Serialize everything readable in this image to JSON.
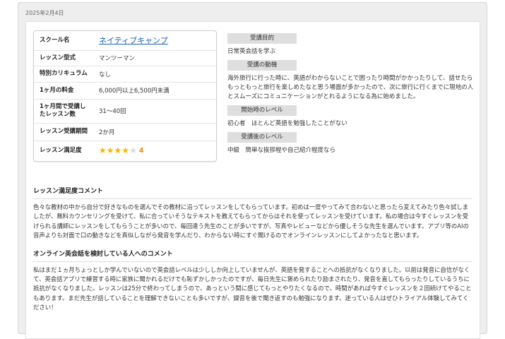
{
  "date": "2025年2月4日",
  "info": {
    "school": {
      "label": "スクール名",
      "value": "ネイティブキャンプ"
    },
    "lesson_type": {
      "label": "レッスン型式",
      "value": "マンツーマン"
    },
    "curriculum": {
      "label": "特別カリキュラム",
      "value": "なし"
    },
    "fee": {
      "label": "1ヶ月の料金",
      "value": "6,000円以上6,500円未満"
    },
    "lessons": {
      "label": "1ヶ月間で受講したレッスン数",
      "value": "31～40回"
    },
    "period": {
      "label": "レッスン受講期間",
      "value": "2か月"
    },
    "satisfaction": {
      "label": "レッスン満足度",
      "stars": 4,
      "max": 5,
      "value": "4"
    }
  },
  "sections": {
    "purpose": {
      "title": "受講目的",
      "text": "日常英会話を学ぶ"
    },
    "motive": {
      "title": "受講の動機",
      "text": "海外旅行に行った時に、英語がわからないことで困ったり時間がかかったりして、話せたらもっともっと旅行を楽しめたなと思う場面が多かったので、次に旅行に行くまでに現地の人とスムーズにコミュニケーションがとれるようになる為に始めました。"
    },
    "start_level": {
      "title": "開始時のレベル",
      "text": "初心者　ほとんど英語を勉強したことがない"
    },
    "after_level": {
      "title": "受講後のレベル",
      "text": "中級　簡単な挨拶程や自己紹介程度なら"
    }
  },
  "comments": {
    "satisfaction": {
      "title": "レッスン満足度コメント",
      "text": "色々な教材の中から自分で好きなものを選んでその教材に沿ってレッスンをしてもらっています。初めは一度やってみて合わないと思ったら変えてみたり色々試しましたが、無料カウンセリングを受けて、私に合っていそうなテキストを教えてもらってからはそれを使ってレッスンを受けています。私の場合は今すぐレッスンを受けられる講師にレッスンをしてもらうことが多いので、毎回違う先生のことが多いですが、写真やレビューなどから優しそうな先生を選んでいます。アプリ等のAIの音声よりも対面で口の動きなどを真似しながら発音を学んだり、わからない時にすぐ聞けるのでオンラインレッスンにしてよかったなと思います。"
    },
    "consider": {
      "title": "オンライン英会話を検討している人へのコメント",
      "text": "私はまだ１ヵ月ちょっとしか学んでいないので英会話レベルは少ししか向上していませんが、英語を発することへの抵抗がなくなりました。以前は発音に自信がなくて、英会話アプリで練習する時に家族に聞かれるだけでも恥ずかしかったのですが、毎日先生に褒められたり励まされたり、発音を直してもらったりしているうちに抵抗がなくなりました。レッスンは25分で終わってしまうので、あっという間に感じてもっとやりたくなるので、時間があれば今すぐレッスンを２回続けてやることもあります。まだ先生が話していることを理解できないことも多いですが、録音を後で聞き返すのも勉強になります。迷っている人はぜひトライアル体験してみてください！"
    }
  },
  "colors": {
    "link": "#1a5fb4",
    "star": "#f5b400",
    "rating": "#f08c00",
    "tag_bg": "#dedede"
  }
}
